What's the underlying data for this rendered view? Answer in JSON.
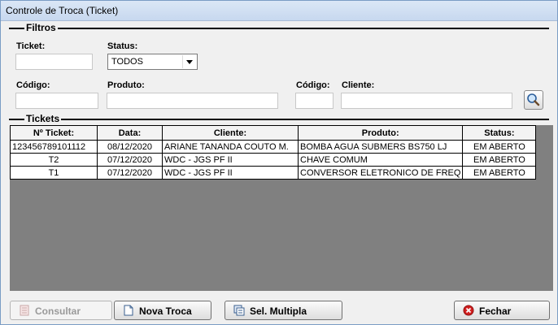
{
  "window": {
    "title": "Controle de Troca (Ticket)"
  },
  "filtros": {
    "group_title": "Filtros",
    "ticket_label": "Ticket:",
    "ticket_value": "",
    "status_label": "Status:",
    "status_value": "TODOS",
    "codigo_produto_label": "Código:",
    "codigo_produto_value": "",
    "produto_label": "Produto:",
    "produto_value": "",
    "codigo_cliente_label": "Código:",
    "codigo_cliente_value": "",
    "cliente_label": "Cliente:",
    "cliente_value": "",
    "search_icon": "magnifier-icon"
  },
  "tickets": {
    "group_title": "Tickets",
    "columns": [
      "Nº Ticket:",
      "Data:",
      "Cliente:",
      "Produto:",
      "Status:"
    ],
    "rows": [
      [
        "123456789101112",
        "08/12/2020",
        "ARIANE TANANDA COUTO M.",
        "BOMBA AGUA SUBMERS BS750 LJ",
        "EM ABERTO"
      ],
      [
        "T2",
        "07/12/2020",
        "WDC - JGS PF II",
        "CHAVE COMUM",
        "EM ABERTO"
      ],
      [
        "T1",
        "07/12/2020",
        "WDC - JGS PF II",
        "CONVERSOR ELETRONICO DE FREQ",
        "EM ABERTO"
      ]
    ]
  },
  "buttons": {
    "consultar": "Consultar",
    "nova_troca": "Nova Troca",
    "sel_multipla": "Sel. Multipla",
    "fechar": "Fechar"
  },
  "colors": {
    "grid_background": "#808080",
    "title_bar": "#c7d8ef",
    "close_icon": "#d22020"
  }
}
